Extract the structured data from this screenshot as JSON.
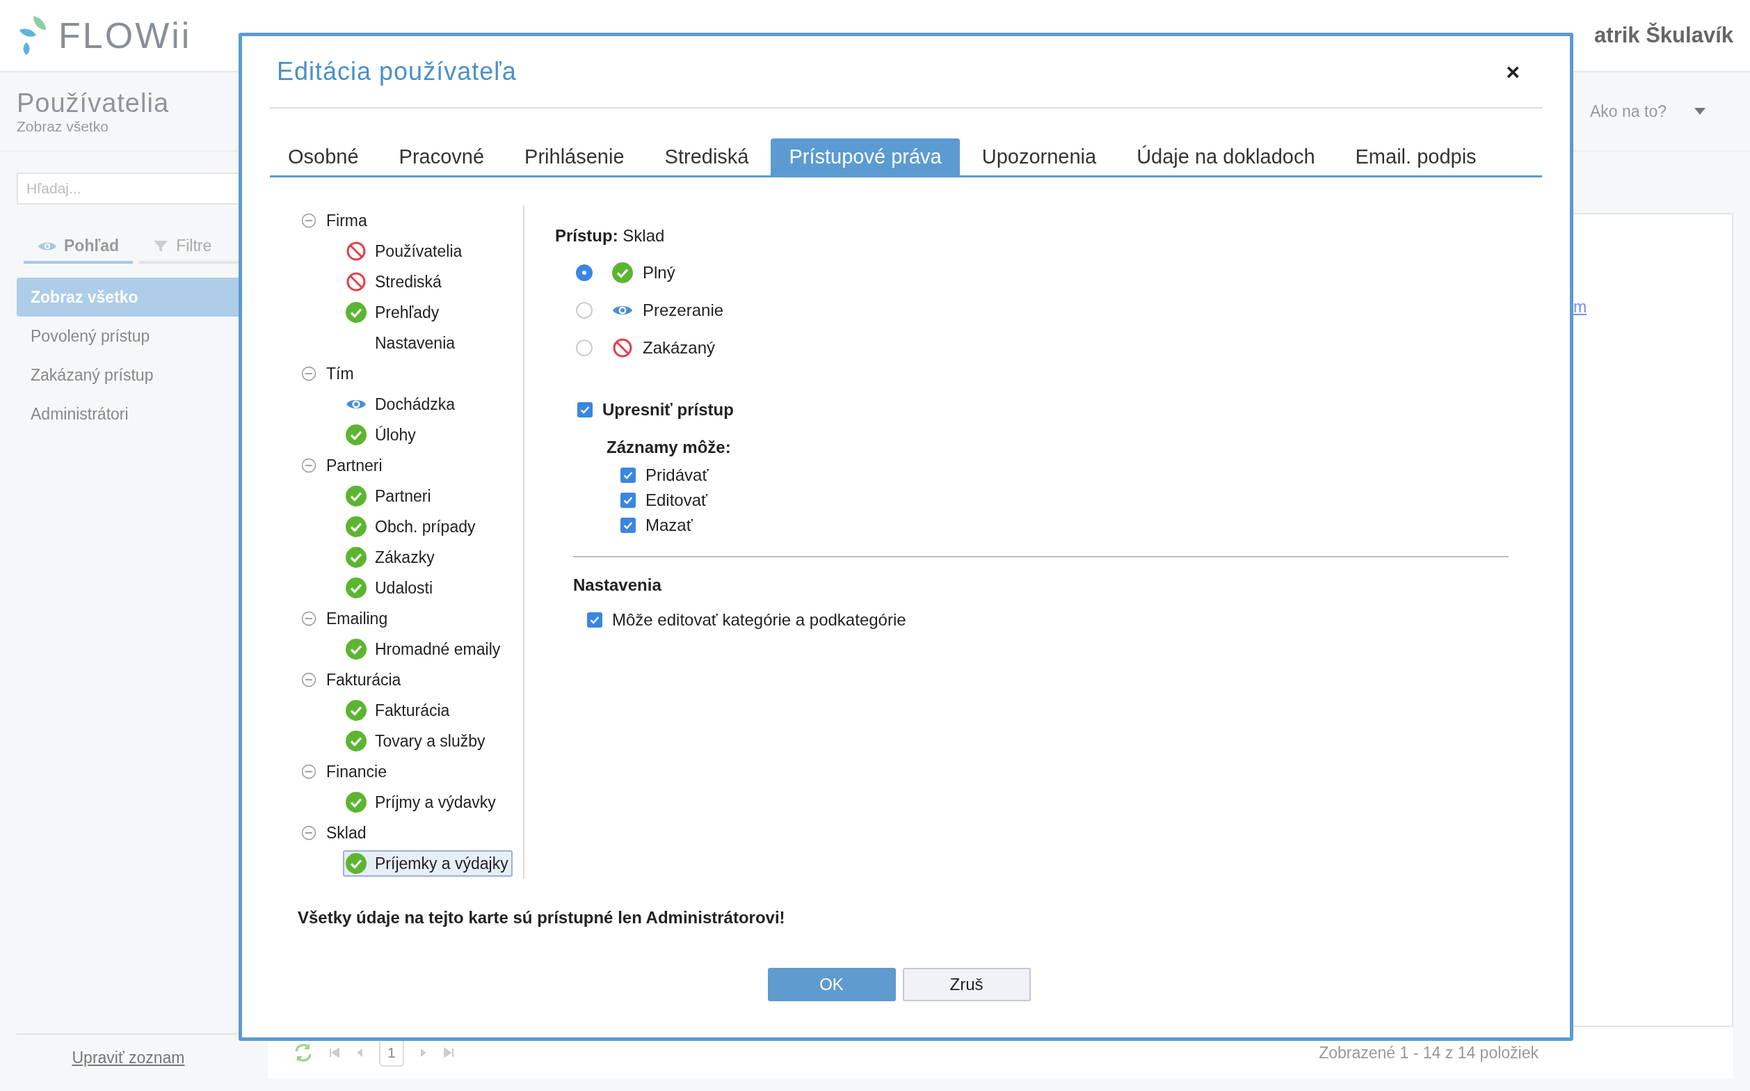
{
  "header": {
    "logo": "FLOWii",
    "user": "atrik Škulavík"
  },
  "page": {
    "title": "Používatelia",
    "subtitle": "Zobraz všetko",
    "help": "Ako na to?"
  },
  "sidebar": {
    "search": {
      "placeholder": "Hľadaj..."
    },
    "tabs": [
      {
        "label": "Pohľad",
        "selected": true
      },
      {
        "label": "Filtre",
        "selected": false
      }
    ],
    "items": [
      {
        "label": "Zobraz všetko",
        "selected": true
      },
      {
        "label": "Povolený prístup",
        "selected": false
      },
      {
        "label": "Zakázaný prístup",
        "selected": false
      },
      {
        "label": "Administrátori",
        "selected": false
      }
    ],
    "footer_link": "Upraviť zoznam"
  },
  "content": {
    "link_fragment": "m",
    "pager": {
      "page": "1",
      "summary": "Zobrazené 1 - 14 z 14 položiek"
    }
  },
  "dialog": {
    "title": "Editácia používateľa",
    "close": "×",
    "tabs": [
      {
        "label": "Osobné",
        "selected": false
      },
      {
        "label": "Pracovné",
        "selected": false
      },
      {
        "label": "Prihlásenie",
        "selected": false
      },
      {
        "label": "Strediská",
        "selected": false
      },
      {
        "label": "Prístupové práva",
        "selected": true
      },
      {
        "label": "Upozornenia",
        "selected": false
      },
      {
        "label": "Údaje na dokladoch",
        "selected": false
      },
      {
        "label": "Email. podpis",
        "selected": false
      }
    ],
    "tree": [
      {
        "label": "Firma",
        "expanded": true,
        "children": [
          {
            "label": "Používatelia",
            "kind": "denied",
            "selected": false
          },
          {
            "label": "Strediská",
            "kind": "denied",
            "selected": false
          },
          {
            "label": "Prehľady",
            "kind": "full",
            "selected": false
          },
          {
            "label": "Nastavenia",
            "kind": "none",
            "selected": false
          }
        ]
      },
      {
        "label": "Tím",
        "expanded": true,
        "children": [
          {
            "label": "Dochádzka",
            "kind": "view",
            "selected": false
          },
          {
            "label": "Úlohy",
            "kind": "full",
            "selected": false
          }
        ]
      },
      {
        "label": "Partneri",
        "expanded": true,
        "children": [
          {
            "label": "Partneri",
            "kind": "full",
            "selected": false
          },
          {
            "label": "Obch. prípady",
            "kind": "full",
            "selected": false
          },
          {
            "label": "Zákazky",
            "kind": "full",
            "selected": false
          },
          {
            "label": "Udalosti",
            "kind": "full",
            "selected": false
          }
        ]
      },
      {
        "label": "Emailing",
        "expanded": true,
        "children": [
          {
            "label": "Hromadné emaily",
            "kind": "full",
            "selected": false
          }
        ]
      },
      {
        "label": "Fakturácia",
        "expanded": true,
        "children": [
          {
            "label": "Fakturácia",
            "kind": "full",
            "selected": false
          },
          {
            "label": "Tovary a služby",
            "kind": "full",
            "selected": false
          }
        ]
      },
      {
        "label": "Financie",
        "expanded": true,
        "children": [
          {
            "label": "Príjmy a výdavky",
            "kind": "full",
            "selected": false
          }
        ]
      },
      {
        "label": "Sklad",
        "expanded": true,
        "children": [
          {
            "label": "Príjemky a výdajky",
            "kind": "full",
            "selected": true
          }
        ]
      }
    ],
    "access": {
      "heading": "**Prístup:** Sklad",
      "options": [
        {
          "label": "Plný",
          "kind": "full",
          "selected": true
        },
        {
          "label": "Prezeranie",
          "kind": "view",
          "selected": false
        },
        {
          "label": "Zakázaný",
          "kind": "denied",
          "selected": false
        }
      ]
    },
    "refine": {
      "label": "Upresniť prístup",
      "checked": true
    },
    "records": {
      "label": "Záznamy môže:",
      "items": [
        {
          "label": "Pridávať",
          "checked": true
        },
        {
          "label": "Editovať",
          "checked": true
        },
        {
          "label": "Mazať",
          "checked": true
        }
      ]
    },
    "settings": {
      "title": "Nastavenia",
      "items": [
        {
          "label": "Môže editovať kategórie a podkategórie",
          "checked": true
        }
      ]
    },
    "note": "Všetky údaje na tejto karte sú prístupné len Administrátorovi!",
    "buttons": [
      {
        "label": "OK",
        "kind": "primary"
      },
      {
        "label": "Zruš",
        "kind": "secondary"
      }
    ]
  }
}
